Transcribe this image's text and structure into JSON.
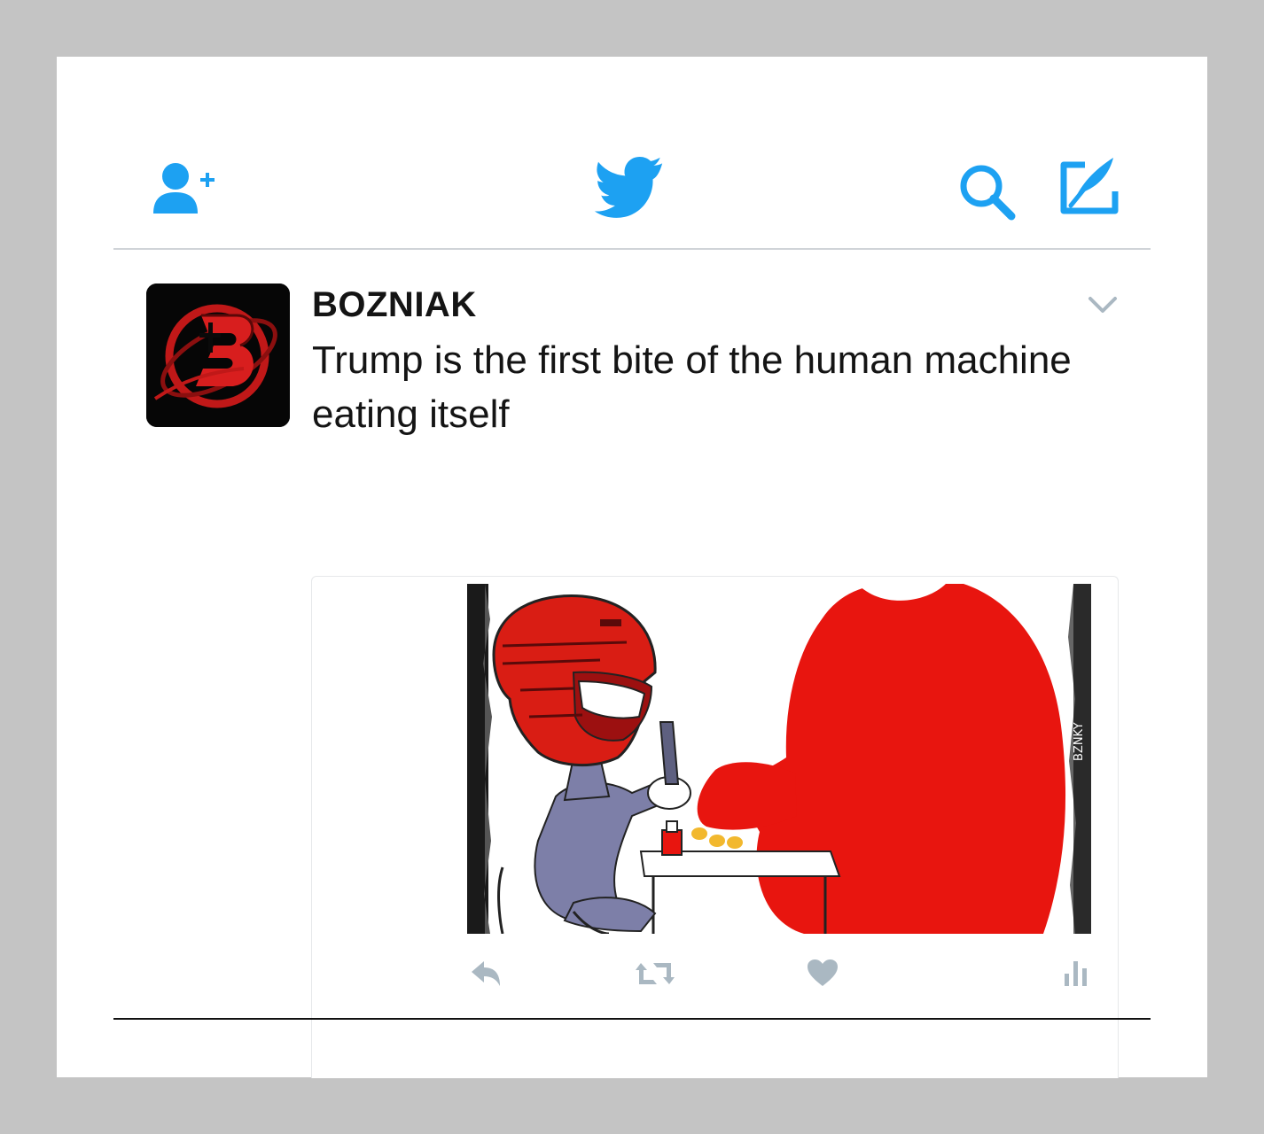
{
  "nav": {
    "add_user_icon": "add-user-icon",
    "logo_icon": "twitter-bird-icon",
    "search_icon": "search-icon",
    "compose_icon": "compose-icon",
    "accent_color": "#1da1f2"
  },
  "tweet": {
    "author": "BOZNIAK",
    "text": "Trump is the first bite of the human machine eating itself",
    "avatar_icon": "bozniak-logo",
    "menu_icon": "chevron-down-icon",
    "media_icon": "cartoon-illustration",
    "actions": {
      "reply_icon": "reply-icon",
      "retweet_icon": "retweet-icon",
      "like_icon": "heart-icon",
      "analytics_icon": "analytics-icon",
      "color": "#aab8c2"
    }
  }
}
